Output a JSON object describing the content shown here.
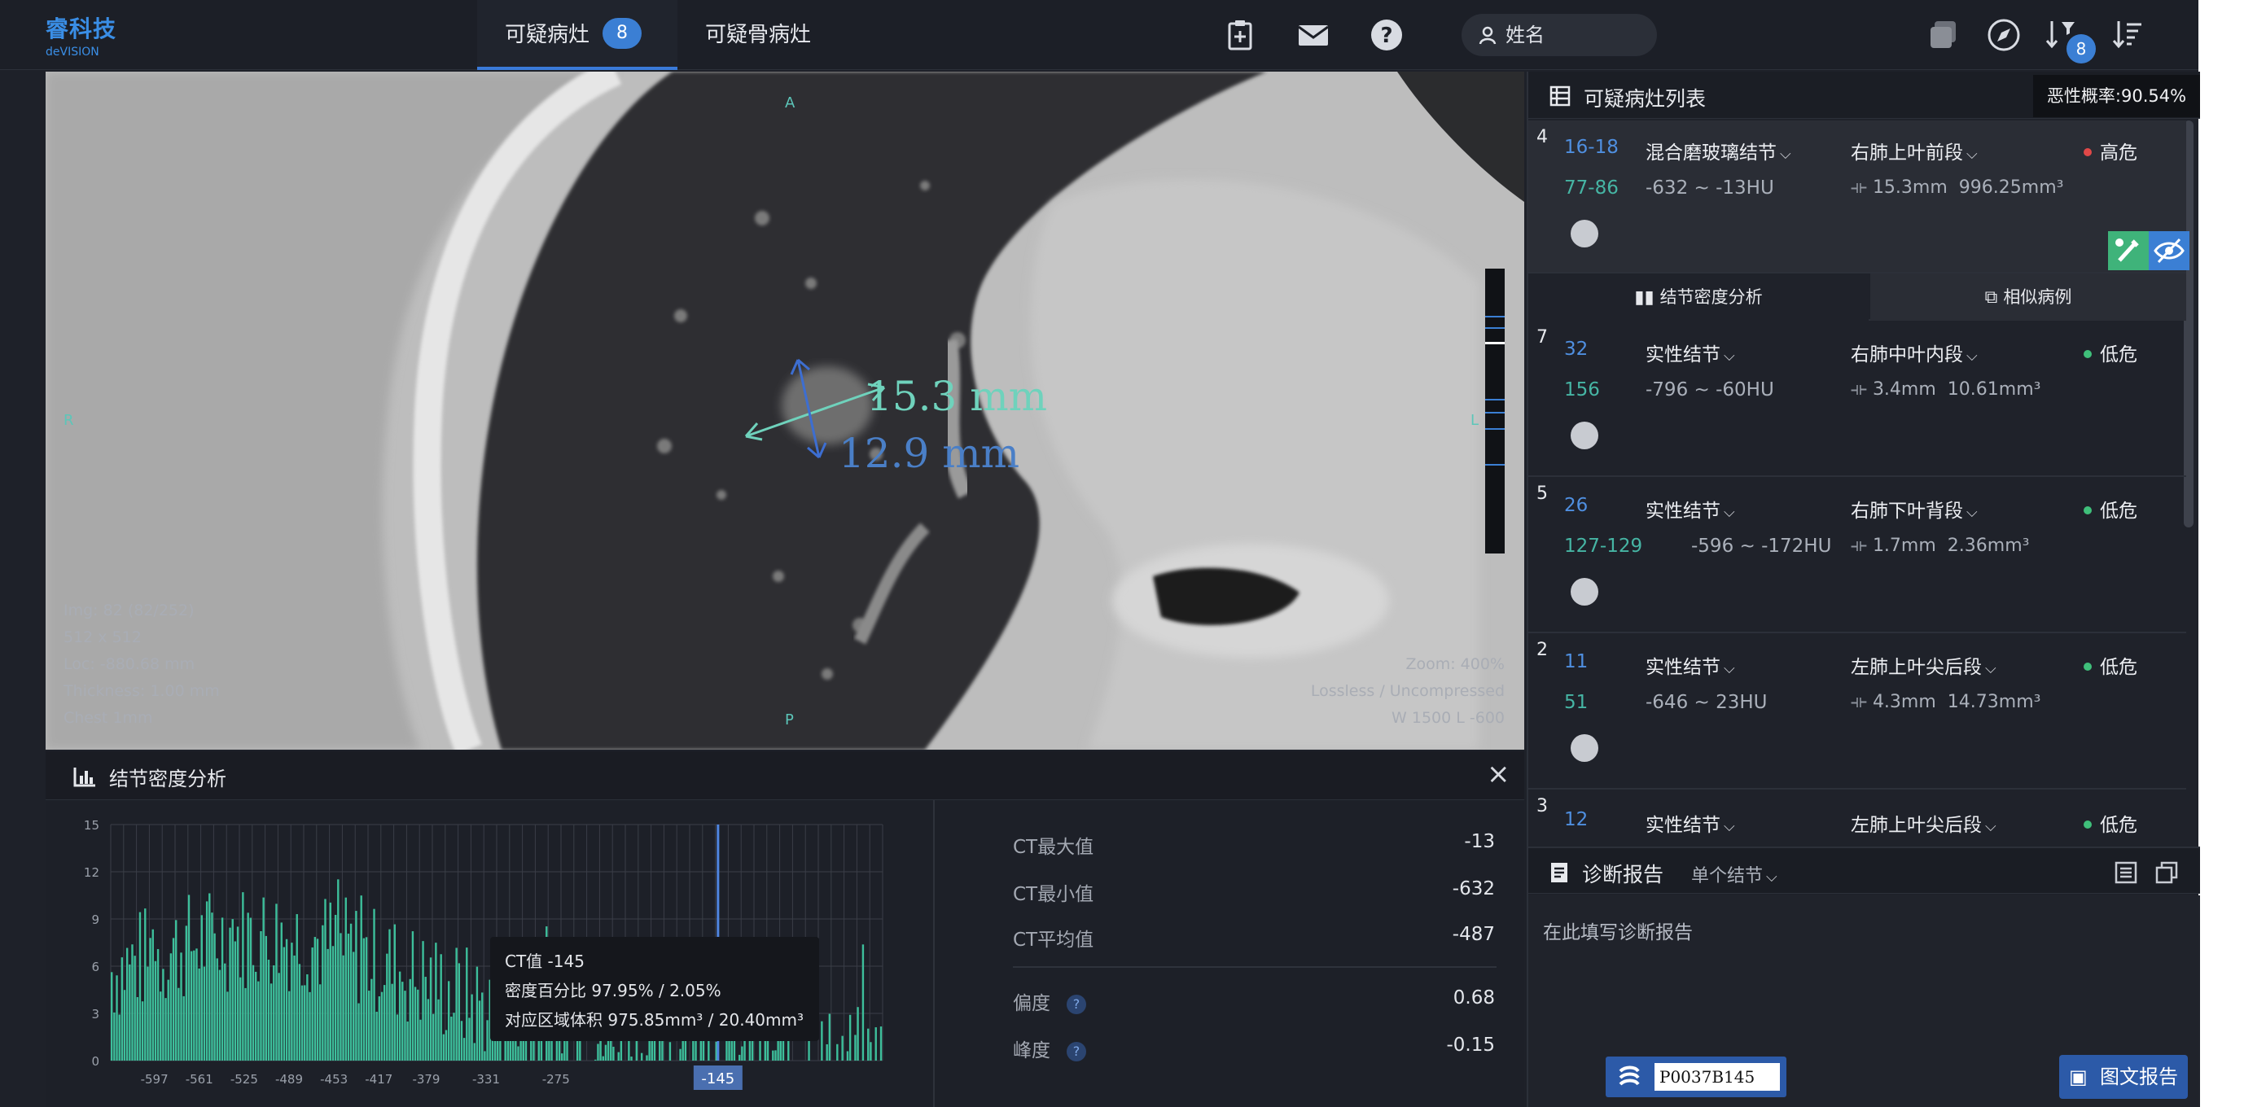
{
  "header": {
    "logo_line1": "睿科技",
    "logo_line2": "deVISION",
    "tabs": [
      {
        "label": "可疑病灶",
        "badge": "8"
      },
      {
        "label": "可疑骨病灶"
      }
    ],
    "search_placeholder": "姓名",
    "right_badge": "8",
    "icons": [
      "clipboard-plus-icon",
      "mail-icon",
      "help-icon",
      "user-icon",
      "layers-icon",
      "compass-icon",
      "sort-desc-filter-icon",
      "sort-list-icon"
    ]
  },
  "viewer": {
    "info_left": [
      "Img: 82 (82/252)",
      "512 x 512",
      "Loc: -880.68 mm",
      "Thickness: 1.00 mm",
      "Chest 1mm"
    ],
    "info_right": [
      "Zoom: 400%",
      "Lossless / Uncompressed",
      "W 1500 L -600"
    ],
    "orient_top": "A",
    "orient_left": "R",
    "orient_right": "L",
    "orient_bottom": "P",
    "measure_long": "15.3 mm",
    "measure_short": "12.9 mm"
  },
  "density_panel": {
    "title": "结节密度分析",
    "close": "×",
    "tooltip": {
      "ct": "CT值 -145",
      "density": "密度百分比 97.95% / 2.05%",
      "volume": "对应区域体积 975.85mm³ / 20.40mm³"
    },
    "stats": [
      {
        "label": "CT最大值",
        "value": "-13"
      },
      {
        "label": "CT最小值",
        "value": "-632"
      },
      {
        "label": "CT平均值",
        "value": "-487"
      },
      {
        "label": "偏度",
        "value": "0.68"
      },
      {
        "label": "峰度",
        "value": "-0.15"
      }
    ],
    "qmark": "?"
  },
  "chart_data": {
    "type": "bar",
    "title": "",
    "xlabel": "",
    "ylabel": "",
    "x_ticks": [
      -597,
      -561,
      -525,
      -489,
      -453,
      -417,
      -379,
      -331,
      -275
    ],
    "y_ticks": [
      0,
      3,
      6,
      9,
      12,
      15
    ],
    "ylim": [
      0,
      15
    ],
    "xlim": [
      -632,
      -13
    ],
    "marker_x": -145,
    "marker_label": "-145",
    "grid": true,
    "color": "#3dbf9b"
  },
  "nodule_list": {
    "title": "可疑病灶列表",
    "malignancy_tip": "恶性概率:90.54%",
    "items": [
      {
        "num": "4",
        "range1": "16-18",
        "range2": "77-86",
        "type": "混合磨玻璃结节",
        "hu": "-632 ~ -13HU",
        "location": "右肺上叶前段",
        "size": "15.3mm",
        "volume": "996.25mm³",
        "risk": "高危",
        "risk_color": "#e04848"
      },
      {
        "num": "7",
        "range1": "32",
        "range2": "156",
        "type": "实性结节",
        "hu": "-796 ~ -60HU",
        "location": "右肺中叶内段",
        "size": "3.4mm",
        "volume": "10.61mm³",
        "risk": "低危",
        "risk_color": "#3fbf7a"
      },
      {
        "num": "5",
        "range1": "26",
        "range2": "127-129",
        "type": "实性结节",
        "hu": "-596 ~ -172HU",
        "location": "右肺下叶背段",
        "size": "1.7mm",
        "volume": "2.36mm³",
        "risk": "低危",
        "risk_color": "#3fbf7a"
      },
      {
        "num": "2",
        "range1": "11",
        "range2": "51",
        "type": "实性结节",
        "hu": "-646 ~ 23HU",
        "location": "左肺上叶尖后段",
        "size": "4.3mm",
        "volume": "14.73mm³",
        "risk": "低危",
        "risk_color": "#3fbf7a"
      },
      {
        "num": "3",
        "range1": "12",
        "type": "实性结节",
        "location": "左肺上叶尖后段",
        "risk": "低危",
        "risk_color": "#3fbf7a"
      }
    ],
    "subtabs": [
      "结节密度分析",
      "相似病例"
    ]
  },
  "report": {
    "title": "诊断报告",
    "mode": "单个结节",
    "placeholder": "在此填写诊断报告",
    "patient_id": "P0037B145",
    "report_button": "图文报告"
  }
}
